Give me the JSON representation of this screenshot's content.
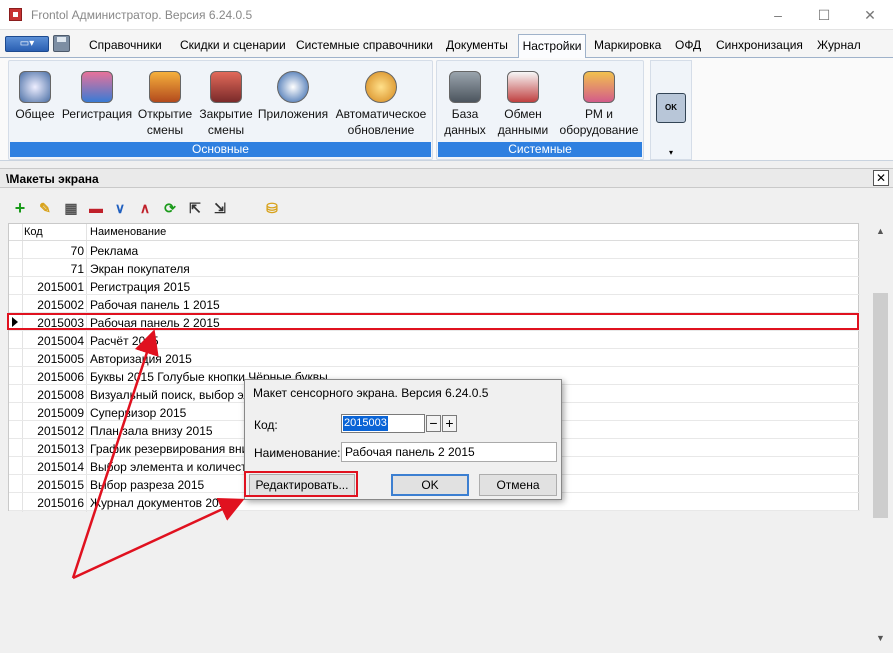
{
  "window": {
    "title": "Frontol Администратор. Версия 6.24.0.5",
    "min": "–",
    "max": "☐",
    "close": "✕"
  },
  "app_menu": {
    "label": "▭▾"
  },
  "menu_tabs": [
    "Справочники",
    "Скидки и сценарии",
    "Системные справочники",
    "Документы",
    "Настройки",
    "Маркировка",
    "ОФД",
    "Синхронизация",
    "Журнал"
  ],
  "active_tab": "Настройки",
  "ribbon": {
    "groups": [
      {
        "caption": "Основные",
        "buttons": [
          "Общее",
          "Регистрация",
          "Открытие\nсмены",
          "Закрытие\nсмены",
          "Приложения",
          "Автоматическое\nобновление"
        ]
      },
      {
        "caption": "Системные",
        "buttons": [
          "База\nданных",
          "Обмен\nданными",
          "РМ и\nоборудование"
        ]
      }
    ],
    "more_label": "OK",
    "more_arrow": "▾"
  },
  "panel": {
    "title": "\\Макеты экрана",
    "close": "✕"
  },
  "toolbar": {
    "icons": [
      "add-icon",
      "edit-icon",
      "copy-icon",
      "delete-icon",
      "move-down-icon",
      "move-up-icon",
      "refresh-icon",
      "export-icon",
      "import-icon",
      "clear-filter-icon"
    ]
  },
  "grid": {
    "columns": [
      "Код",
      "Наименование"
    ],
    "rows": [
      {
        "code": "70",
        "name": "Реклама"
      },
      {
        "code": "71",
        "name": "Экран покупателя"
      },
      {
        "code": "2015001",
        "name": "Регистрация 2015"
      },
      {
        "code": "2015002",
        "name": "Рабочая панель 1 2015"
      },
      {
        "code": "2015003",
        "name": "Рабочая панель 2 2015"
      },
      {
        "code": "2015004",
        "name": "Расчёт 2015"
      },
      {
        "code": "2015005",
        "name": "Авторизация 2015"
      },
      {
        "code": "2015006",
        "name": "Буквы 2015 Голубые кнопки Чёрные буквы"
      },
      {
        "code": "2015008",
        "name": "Визуальный поиск, выбор элемента"
      },
      {
        "code": "2015009",
        "name": "Супервизор 2015"
      },
      {
        "code": "2015012",
        "name": "План зала внизу 2015"
      },
      {
        "code": "2015013",
        "name": "График резервирования внизу"
      },
      {
        "code": "2015014",
        "name": "Выбор элемента и количества"
      },
      {
        "code": "2015015",
        "name": "Выбор разреза 2015"
      },
      {
        "code": "2015016",
        "name": "Журнал документов 2015"
      }
    ],
    "selected_code": "2015003"
  },
  "dialog": {
    "title": "Макет сенсорного экрана. Версия 6.24.0.5",
    "code_label": "Код:",
    "code_value": "2015003",
    "minus": "−",
    "plus": "+",
    "name_label": "Наименование:",
    "name_value": "Рабочая панель 2 2015",
    "edit_button": "Редактировать...",
    "ok_button": "OK",
    "cancel_button": "Отмена"
  },
  "colors": {
    "highlight": "#e0111f",
    "ribbon_caption": "#2f80e0",
    "selection": "#0a64d6"
  }
}
